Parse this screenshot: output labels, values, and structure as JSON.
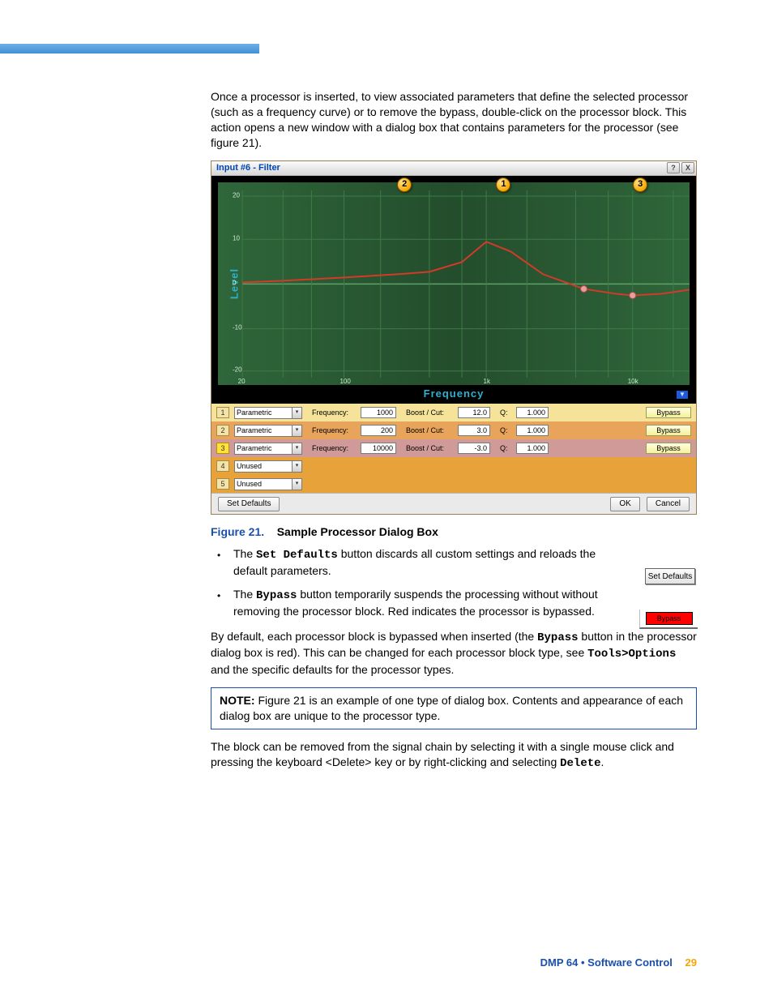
{
  "topbar": true,
  "intro": "Once a processor is inserted, to view associated parameters that define the selected processor (such as a frequency curve) or to remove the bypass, double-click on the processor block. This action opens a new window with a dialog box that contains parameters for the processor (see figure 21).",
  "dialog": {
    "title": "Input #6 - Filter",
    "help": "?",
    "close": "X",
    "ylabel": "Level",
    "xlabel": "Frequency",
    "callouts": [
      {
        "n": "2",
        "leftPct": 38
      },
      {
        "n": "1",
        "leftPct": 59
      },
      {
        "n": "3",
        "leftPct": 88
      }
    ],
    "yticks": [
      {
        "v": "20",
        "pct": 7
      },
      {
        "v": "10",
        "pct": 28
      },
      {
        "v": "0",
        "pct": 50
      },
      {
        "v": "-10",
        "pct": 72
      },
      {
        "v": "-20",
        "pct": 93
      }
    ],
    "xticks": [
      {
        "v": "20",
        "pct": 5
      },
      {
        "v": "100",
        "pct": 27
      },
      {
        "v": "1k",
        "pct": 57
      },
      {
        "v": "10k",
        "pct": 88
      }
    ],
    "rows": [
      {
        "cls": "r1",
        "n": "1",
        "type": "Parametric",
        "freqLbl": "Frequency:",
        "freq": "1000",
        "bcLbl": "Boost / Cut:",
        "bc": "12.0",
        "qLbl": "Q:",
        "q": "1.000",
        "bypass": "Bypass"
      },
      {
        "cls": "r2",
        "n": "2",
        "type": "Parametric",
        "freqLbl": "Frequency:",
        "freq": "200",
        "bcLbl": "Boost / Cut:",
        "bc": "3.0",
        "qLbl": "Q:",
        "q": "1.000",
        "bypass": "Bypass"
      },
      {
        "cls": "r3",
        "n": "3",
        "type": "Parametric",
        "freqLbl": "Frequency:",
        "freq": "10000",
        "bcLbl": "Boost / Cut:",
        "bc": "-3.0",
        "qLbl": "Q:",
        "q": "1.000",
        "bypass": "Bypass"
      },
      {
        "cls": "r4",
        "n": "4",
        "type": "Unused"
      },
      {
        "cls": "r5",
        "n": "5",
        "type": "Unused"
      }
    ],
    "buttons": {
      "setDefaults": "Set Defaults",
      "ok": "OK",
      "cancel": "Cancel"
    }
  },
  "figcap": {
    "fig": "Figure 21.",
    "rest": "Sample Processor Dialog Box"
  },
  "bullets": [
    {
      "pre": "The ",
      "mono": "Set Defaults",
      "post": " button discards all custom settings and reloads the default parameters."
    },
    {
      "pre": "The ",
      "mono": "Bypass",
      "post": " button temporarily suspends the processing without without removing the processor block. Red indicates the processor is bypassed."
    }
  ],
  "side": {
    "setDefaults": "Set Defaults",
    "bypass": "Bypass"
  },
  "para2a": "By default, each processor block is bypassed when inserted (the ",
  "para2b": "Bypass",
  "para2c": " button in the processor dialog box is red). This can be changed for each processor block type, see ",
  "para2d": "Tools>Options",
  "para2e": " and the specific defaults for the processor types.",
  "noteLead": "NOTE:",
  "noteBody": " Figure 21 is an example of one type of dialog box. Contents and appearance of each dialog box are unique to the processor type.",
  "para3a": "The block can be removed from the signal chain by selecting it with a single mouse click and pressing the keyboard <Delete> key or by right-clicking and selecting ",
  "para3b": "Delete",
  "para3c": ".",
  "footer": {
    "text": "DMP 64 • Software Control",
    "page": "29"
  },
  "chart_data": {
    "type": "line",
    "title": "Input #6 - Filter",
    "xlabel": "Frequency",
    "ylabel": "Level",
    "xscale": "log",
    "xlim": [
      20,
      20000
    ],
    "ylim": [
      -25,
      25
    ],
    "x_tick_labels": [
      "20",
      "100",
      "1k",
      "10k"
    ],
    "y_tick_labels": [
      "20",
      "10",
      "0",
      "-10",
      "-20"
    ],
    "series": [
      {
        "name": "Composite EQ curve",
        "x": [
          20,
          50,
          100,
          200,
          400,
          700,
          1000,
          1500,
          2500,
          5000,
          8000,
          10000,
          15000,
          20000
        ],
        "values": [
          0.5,
          1.0,
          2.0,
          3.0,
          3.5,
          6.0,
          12.0,
          9.0,
          3.0,
          -1.5,
          -2.8,
          -3.0,
          -2.5,
          -1.5
        ]
      }
    ],
    "markers": [
      {
        "label": "1",
        "x": 1000,
        "y": 12.0
      },
      {
        "label": "2",
        "x": 200,
        "y": 3.0
      },
      {
        "label": "3",
        "x": 10000,
        "y": -3.0
      }
    ],
    "handles": [
      {
        "x": 5000,
        "y": -1.5
      },
      {
        "x": 10000,
        "y": -3.0
      }
    ]
  }
}
